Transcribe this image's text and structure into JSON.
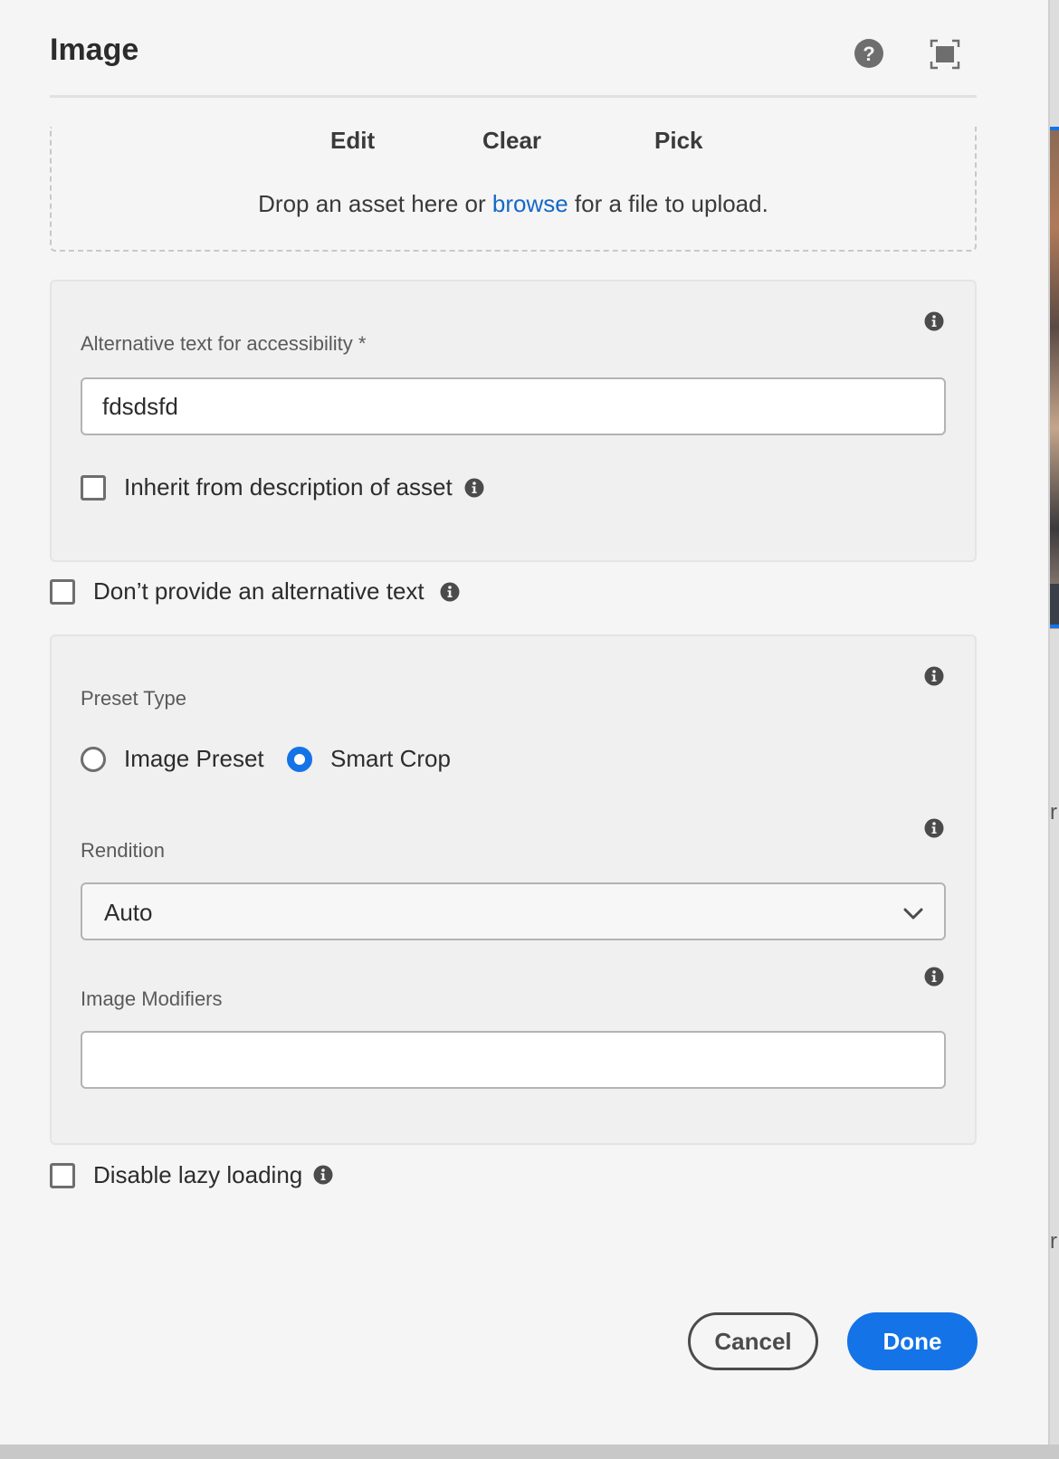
{
  "dialog": {
    "title": "Image"
  },
  "dropzone": {
    "edit_label": "Edit",
    "clear_label": "Clear",
    "pick_label": "Pick",
    "text_before": "Drop an asset here or ",
    "browse_link": "browse",
    "text_after": " for a file to upload."
  },
  "alt_text": {
    "label": "Alternative text for accessibility *",
    "value": "fdsdsfd",
    "inherit_label": "Inherit from description of asset",
    "inherit_checked": false
  },
  "no_alt": {
    "label": "Don’t provide an alternative text",
    "checked": false
  },
  "preset": {
    "label": "Preset Type",
    "options": [
      "Image Preset",
      "Smart Crop"
    ],
    "selected": "Smart Crop",
    "rendition_label": "Rendition",
    "rendition_value": "Auto",
    "modifiers_label": "Image Modifiers",
    "modifiers_value": ""
  },
  "lazy": {
    "label": "Disable lazy loading",
    "checked": false
  },
  "footer": {
    "cancel_label": "Cancel",
    "done_label": "Done"
  },
  "colors": {
    "accent": "#1473e6",
    "link": "#1568c7",
    "background": "#f5f5f5",
    "panel": "#f0f0f0"
  },
  "icons": [
    "help-icon",
    "fullscreen-icon",
    "info-icon",
    "chevron-down-icon"
  ],
  "background_page": {
    "letter_1": "r",
    "letter_2": "r"
  }
}
